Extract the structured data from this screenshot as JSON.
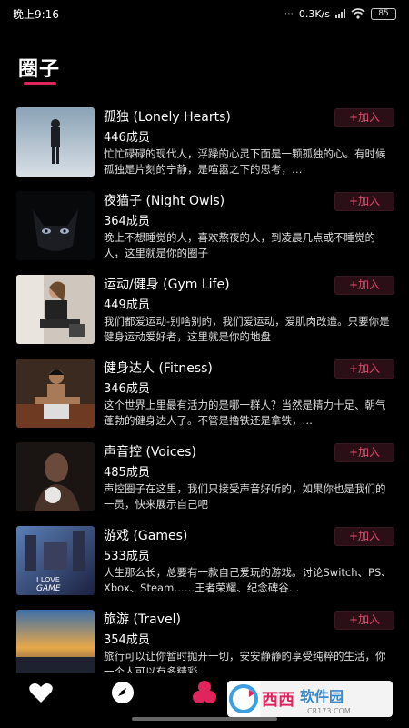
{
  "status": {
    "time": "晚上9:16",
    "network": "0.3K/s",
    "battery": "85"
  },
  "page": {
    "title": "圈子",
    "accent": "#e0245e"
  },
  "join_label": "+加入",
  "groups": [
    {
      "name": "孤独 (Lonely Hearts)",
      "members": "446成员",
      "desc": "忙忙碌碌的现代人，浮躁的心灵下面是一颗孤独的心。有时候孤独是片刻的宁静，是喧嚣之下的思考，…"
    },
    {
      "name": "夜猫子 (Night Owls)",
      "members": "364成员",
      "desc": "晚上不想睡觉的人，喜欢熬夜的人，到凌晨几点或不睡觉的人，这里就是你的圈子"
    },
    {
      "name": "运动/健身 (Gym Life)",
      "members": "449成员",
      "desc": "我们都爱运动-别啥别的，我们爱运动，爱肌肉改造。只要你是健身运动爱好者，这里就是你的地盘"
    },
    {
      "name": "健身达人 (Fitness)",
      "members": "346成员",
      "desc": "这个世界上里最有活力的是哪一群人？当然是精力十足、朝气蓬勃的健身达人了。不管是撸铁还是拿铁，…"
    },
    {
      "name": "声音控 (Voices)",
      "members": "485成员",
      "desc": "声控圈子在这里，我们只接受声音好听的，如果你也是我们的一员，快来展示自己吧"
    },
    {
      "name": "游戏 (Games)",
      "members": "533成员",
      "desc": "人生那么长，总要有一款自己爱玩的游戏。讨论Switch、PS、Xbox、Steam……王者荣耀、纪念碑谷…"
    },
    {
      "name": "旅游 (Travel)",
      "members": "354成员",
      "desc": "旅行可以让你暂时抛开一切，安安静静的享受纯粹的生活，你一个人可以有多精彩"
    }
  ],
  "nav": [
    "heart-icon",
    "compass-icon",
    "circle-icon",
    "chat-icon",
    "profile-icon"
  ],
  "watermark": {
    "text": "西西软件园",
    "url": "CR173.COM"
  }
}
